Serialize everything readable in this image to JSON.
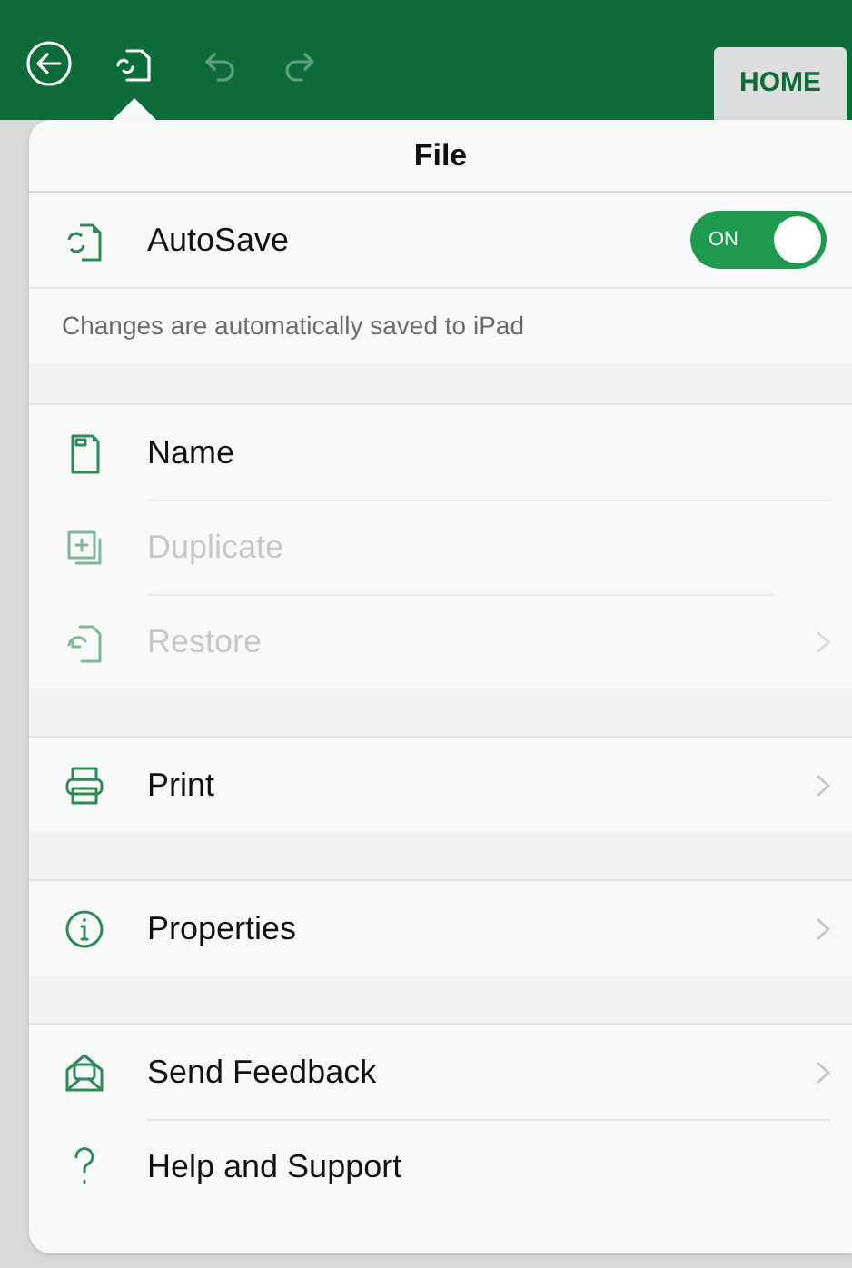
{
  "toolbar": {
    "buttons": [
      {
        "kind": "back",
        "disabled": false,
        "selected": false
      },
      {
        "kind": "file",
        "disabled": false,
        "selected": true
      },
      {
        "kind": "undo",
        "disabled": true,
        "selected": false
      },
      {
        "kind": "redo",
        "disabled": true,
        "selected": false
      }
    ],
    "tabs": [
      {
        "label": "HOME",
        "selected": true
      }
    ]
  },
  "panel": {
    "title": "File",
    "autosave": {
      "label": "AutoSave",
      "on": true,
      "toggle_label": "ON",
      "caption": "Changes are automatically saved to iPad"
    },
    "sections": [
      {
        "items": [
          {
            "label": "Name",
            "disabled": false,
            "chevron": false
          },
          {
            "label": "Duplicate",
            "disabled": true,
            "chevron": false
          },
          {
            "label": "Restore",
            "disabled": true,
            "chevron": true
          }
        ]
      },
      {
        "items": [
          {
            "label": "Print",
            "disabled": false,
            "chevron": true
          }
        ]
      },
      {
        "items": [
          {
            "label": "Properties",
            "disabled": false,
            "chevron": true
          }
        ]
      },
      {
        "items": [
          {
            "label": "Send Feedback",
            "disabled": false,
            "chevron": true
          },
          {
            "label": "Help and Support",
            "disabled": false,
            "chevron": false
          }
        ]
      }
    ]
  }
}
